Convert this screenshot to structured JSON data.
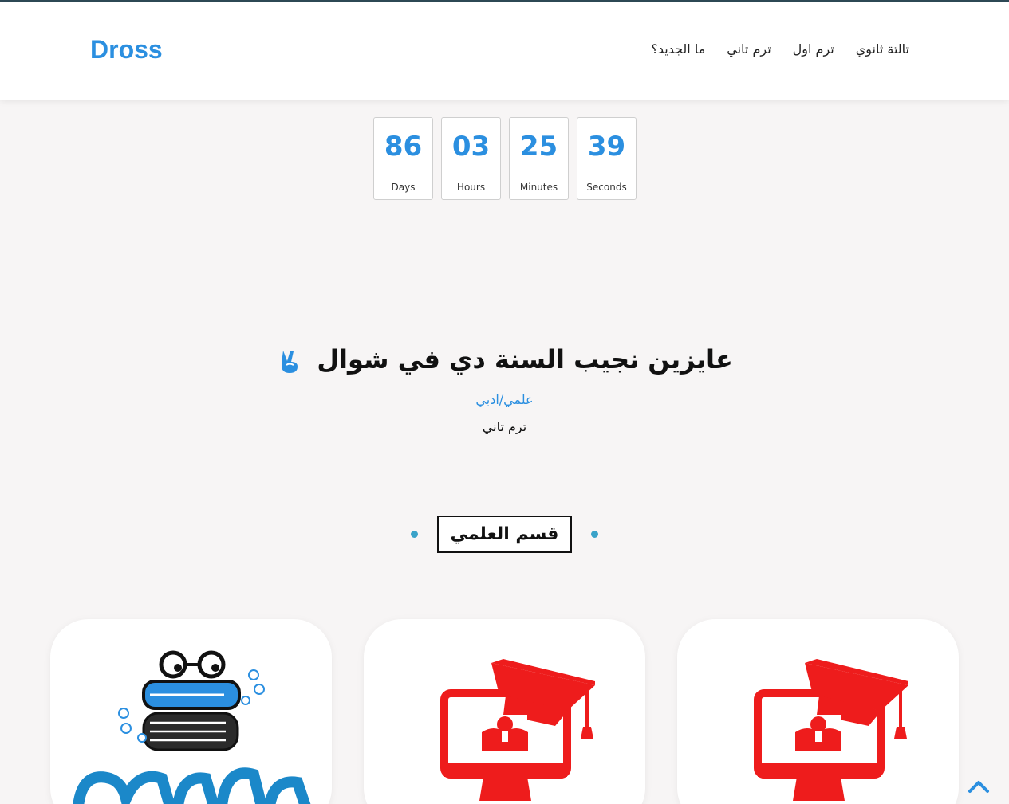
{
  "brand": "Dross",
  "nav": {
    "items": [
      {
        "label": "ما الجديد؟"
      },
      {
        "label": "ترم تاني"
      },
      {
        "label": "ترم اول"
      },
      {
        "label": "تالتة ثانوي"
      }
    ]
  },
  "countdown": [
    {
      "value": "86",
      "label": "Days"
    },
    {
      "value": "03",
      "label": "Hours"
    },
    {
      "value": "25",
      "label": "Minutes"
    },
    {
      "value": "39",
      "label": "Seconds"
    }
  ],
  "hero": {
    "title": "عايزين نجيب السنة دي في شوال",
    "subtitle": "علمي/ادبي",
    "term": "ترم تاني"
  },
  "section": {
    "title": "قسم العلمي"
  },
  "cards": [
    {
      "icon": "graduation-computer-icon"
    },
    {
      "icon": "graduation-computer-icon"
    },
    {
      "icon": "books-glasses-logo"
    }
  ],
  "colors": {
    "accent": "#2b8fe0",
    "card_red": "#ee1c1c",
    "dot": "#3aa3c9"
  }
}
